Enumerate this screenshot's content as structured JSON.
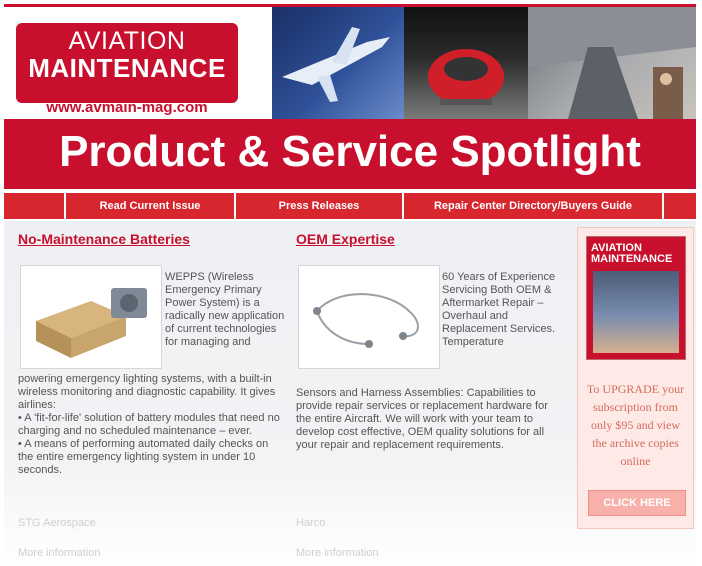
{
  "header": {
    "logo_line1": "AVIATION",
    "logo_line2": "MAINTENANCE",
    "logo_url": "www.avmain-mag.com"
  },
  "banner": {
    "title": "Product & Service Spotlight"
  },
  "nav": {
    "items": [
      "",
      "Read Current Issue",
      "Press Releases",
      "Repair Center Directory/Buyers Guide",
      ""
    ]
  },
  "columns": [
    {
      "title": "No-Maintenance Batteries",
      "side_text": "WEPPS (Wireless Emergency Primary Power System) is a radically new application of current technologies for managing and",
      "body_text": "powering emergency lighting systems, with a built-in wireless monitoring and diagnostic capability. It gives airlines:\n• A 'fit-for-life' solution of battery modules that need no charging and no scheduled maintenance – ever.\n• A means of performing automated daily checks on the entire emergency lighting system in under 10 seconds.",
      "company": "STG Aerospace",
      "more": "More information"
    },
    {
      "title": "OEM Expertise",
      "side_text": "60 Years of Experience Servicing Both OEM & Aftermarket Repair – Overhaul and Replacement Services. Temperature",
      "body_text": "Sensors and Harness Assemblies: Capabilities to provide repair services or replacement hardware for the entire Aircraft. We will work with your team to develop cost effective, OEM quality solutions for all your repair and replacement requirements.",
      "company": "Harco",
      "more": "More information"
    }
  ],
  "ad": {
    "cover_title": "AVIATION MAINTENANCE",
    "text": "To UPGRADE your subscription from only $95 and view the archive copies online",
    "button": "CLICK HERE"
  },
  "colors": {
    "brand_red": "#c8102e"
  }
}
